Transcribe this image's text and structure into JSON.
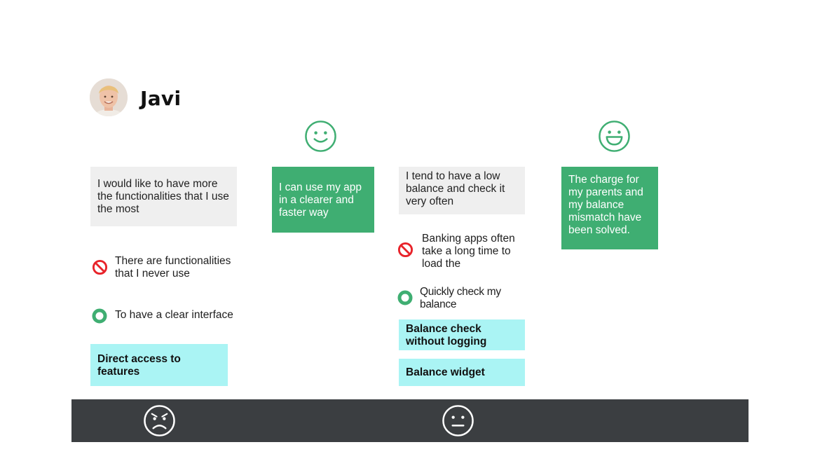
{
  "persona": {
    "name": "Javi"
  },
  "columns": [
    {
      "card": "I would like to have more the functionalities that I use the most",
      "pain_icon": "no-entry-icon",
      "pain": "There are functionalities that I never use",
      "gain_icon": "circle-check-icon",
      "gain": "To have a clear interface",
      "solutions": [
        "Direct access to features"
      ]
    },
    {
      "emotion_icon": "smiley-icon",
      "card": "I can use my app in a clearer and faster way"
    },
    {
      "card": "I tend to have a low balance and check it very often",
      "pain_icon": "no-entry-icon",
      "pain": "Banking apps often take a long time to load the",
      "gain_icon": "circle-check-icon",
      "gain": "Quickly check my balance",
      "solutions": [
        "Balance check without logging",
        "Balance widget"
      ]
    },
    {
      "emotion_icon": "grinning-face-icon",
      "card": "The charge for my parents and my balance mismatch have been solved."
    }
  ],
  "bottom_bar": {
    "icons": [
      "angry-face-icon",
      "neutral-face-icon"
    ]
  },
  "colors": {
    "green": "#3fae72",
    "grey_card": "#efefef",
    "cyan": "#aaf4f4",
    "red": "#e8232a",
    "bar": "#3b3e41"
  }
}
